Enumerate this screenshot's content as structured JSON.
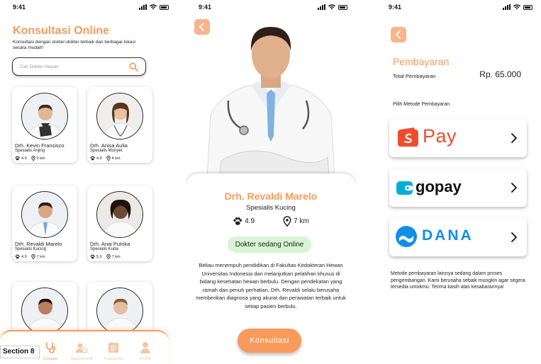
{
  "status": {
    "time": "9:41"
  },
  "colors": {
    "accent": "#F89A5B",
    "online_bg": "#D7F5D2"
  },
  "screen1": {
    "title": "Konsultasi Online",
    "subtitle": "Konsultasi dengan dokter-dokter terbaik dari berbagai lokasi secara mudah!",
    "search_placeholder": "Cari Dokter Hewan",
    "doctors": [
      {
        "name": "Drh. Kevin Fransisco",
        "specialty": "Spesialis Anjing",
        "rating": "4.9",
        "distance": "3 km"
      },
      {
        "name": "Drh. Anisa Aulia",
        "specialty": "Spesialis Monyet",
        "rating": "4.9",
        "distance": "4 km"
      },
      {
        "name": "Drh. Revaldi Marelo",
        "specialty": "Spesialis Kucing",
        "rating": "4.9",
        "distance": "7 km"
      },
      {
        "name": "Drh. Anai Putrika",
        "specialty": "Spesialis Kuda",
        "rating": "5.0",
        "distance": "7 km"
      }
    ],
    "nav": [
      {
        "label": "Consult",
        "icon": "stethoscope-icon"
      },
      {
        "label": "Appointment",
        "icon": "user-clock-icon"
      },
      {
        "label": "Transaction",
        "icon": "receipt-icon"
      },
      {
        "label": "Profile",
        "icon": "person-icon"
      }
    ],
    "section_label": "Section 8"
  },
  "screen2": {
    "name": "Drh. Revaldi Marelo",
    "specialty": "Spesialis Kucing",
    "rating": "4.9",
    "distance": "7 km",
    "status": "Dokter sedang Online",
    "description": "Beliau menempuh pendidikan di Fakultas Kedokteran Hewan Universitas Indonesia dan melanjutkan pelatihan khusus di bidang kesehatan hewan berbulu. Dengan pendekatan yang ramah dan penuh perhatian, Drh. Revaldi selalu berusaha memberikan diagnosa yang akurat dan perawatan terbaik untuk setiap pasien berbulu.",
    "button": "Konsultasi"
  },
  "screen3": {
    "title": "Pembayaran",
    "total_label": "Total Pembayaran",
    "total_value": "Rp. 65.000",
    "method_label": "Pilih Metode Pembayaran",
    "methods": [
      {
        "name": "Pay",
        "icon": "shopeepay-icon"
      },
      {
        "name": "gopay",
        "icon": "gopay-wallet-icon"
      },
      {
        "name": "DANA",
        "icon": "dana-icon"
      }
    ],
    "note": "Metode pembayaran lainnya sedang dalam proses pengembangan. Kami berusaha sebaik mungkin agar segera tersedia untukmu. Terima kasih atas kesabarannya!"
  }
}
